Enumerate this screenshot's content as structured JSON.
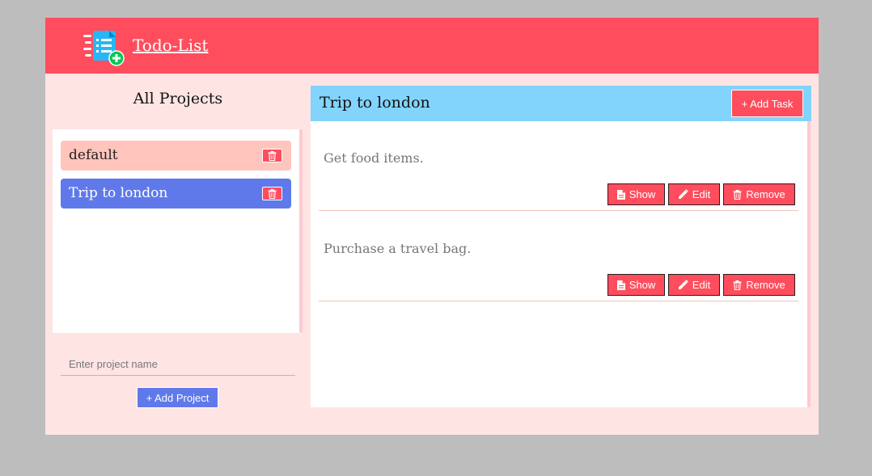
{
  "header": {
    "brand": "Todo-List",
    "logo_icon": "todo-list-icon"
  },
  "sidebar": {
    "title": "All Projects",
    "projects": [
      {
        "name": "default",
        "delete_icon": "trash-icon"
      },
      {
        "name": "Trip to london",
        "delete_icon": "trash-icon",
        "active": true
      }
    ],
    "input_placeholder": "Enter project name",
    "input_value": "",
    "add_button": "+ Add Project"
  },
  "main": {
    "project_title": "Trip to london",
    "add_task_button": "+ Add Task",
    "tasks": [
      {
        "text": "Get food items.",
        "show": "Show",
        "edit": "Edit",
        "remove": "Remove"
      },
      {
        "text": "Purchase a travel bag.",
        "show": "Show",
        "edit": "Edit",
        "remove": "Remove"
      }
    ]
  },
  "colors": {
    "accent": "#ff4d5e",
    "background": "#ffe4e4",
    "project_active": "#6079ea",
    "project_default": "#ffc4bc",
    "main_header": "#82d4fc",
    "page_bg": "#bdbdbd"
  }
}
